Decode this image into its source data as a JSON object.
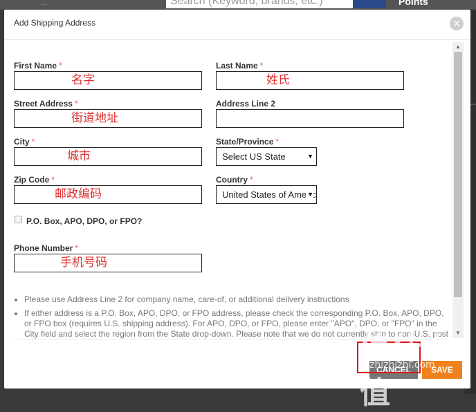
{
  "background": {
    "left_text": "...",
    "search_placeholder": "Search (Keyword, brands, etc.)",
    "right_text": "Points"
  },
  "modal": {
    "title": "Add Shipping Address",
    "close_label": "✕"
  },
  "form": {
    "required_mark": "*",
    "first_name": {
      "label": "First Name",
      "value": "名字"
    },
    "last_name": {
      "label": "Last Name",
      "value": "姓氏"
    },
    "street_address": {
      "label": "Street Address",
      "value": "街道地址"
    },
    "address_line2": {
      "label": "Address Line 2",
      "value": ""
    },
    "city": {
      "label": "City",
      "value": "城市"
    },
    "state": {
      "label": "State/Province",
      "value": "Select US State"
    },
    "zip": {
      "label": "Zip Code",
      "value": "邮政编码"
    },
    "country": {
      "label": "Country",
      "value": "United States of America"
    },
    "po_box": {
      "label": "P.O. Box, APO, DPO, or FPO?"
    },
    "phone": {
      "label": "Phone Number",
      "value": "手机号码"
    }
  },
  "notes": [
    "Please use Address Line 2 for company name, care-of, or additional delivery instructions",
    "If either address is a P.O. Box, APO, DPO, or FPO address, please check the corresponding P.O. Box, APO, DPO, or FPO box (requires U.S. shipping address). For APO, DPO, or FPO, please enter \"APO\", DPO, or \"FPO\" in the City field and select the region from the State drop-down. Please note that we do not currently ship to non-U.S. post office boxes"
  ],
  "buttons": {
    "cancel": "CANCEL",
    "save": "SAVE"
  },
  "watermark": {
    "text": "值什么值",
    "sub": "zhizhizhi.com"
  },
  "colors": {
    "accent_orange": "#f0821e",
    "required_red": "#e05555",
    "input_text_red": "#e03030",
    "highlight_red": "#e0151f"
  }
}
